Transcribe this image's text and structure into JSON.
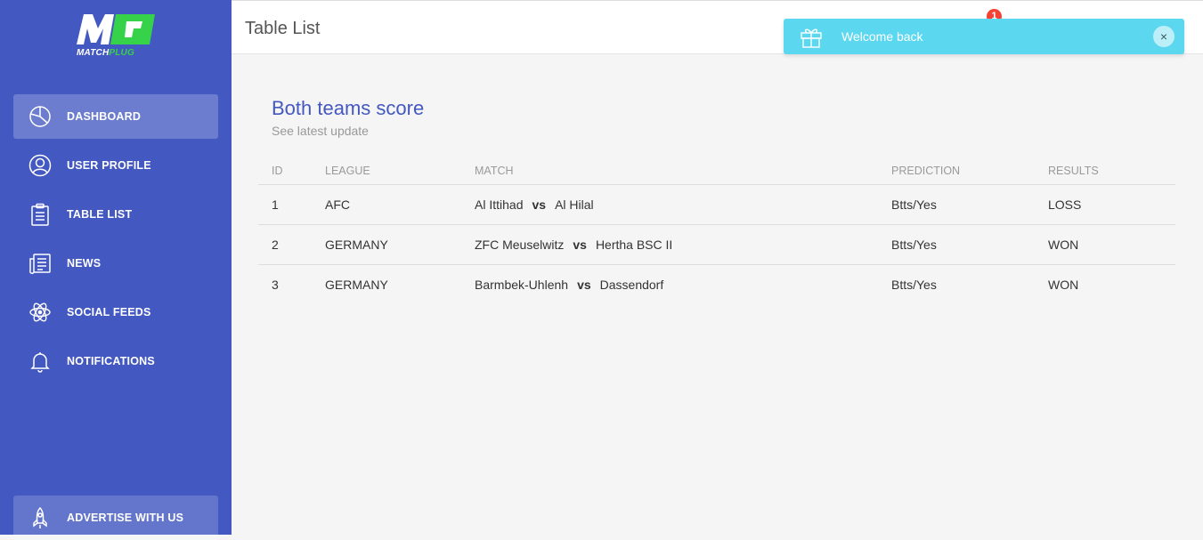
{
  "brand": {
    "logo_letters": "MP",
    "wordmark_a": "MATCH",
    "wordmark_b": "PLUG",
    "primary_color": "#4358c0",
    "accent_color": "#35d24a"
  },
  "sidebar": {
    "items": [
      {
        "label": "DASHBOARD",
        "icon": "pie-chart-icon",
        "active": true
      },
      {
        "label": "USER PROFILE",
        "icon": "user-icon"
      },
      {
        "label": "TABLE LIST",
        "icon": "clipboard-icon"
      },
      {
        "label": "NEWS",
        "icon": "newspaper-icon"
      },
      {
        "label": "SOCIAL FEEDS",
        "icon": "atom-icon"
      },
      {
        "label": "NOTIFICATIONS",
        "icon": "bell-icon"
      }
    ],
    "bottom": {
      "label": "ADVERTISE WITH US",
      "icon": "rocket-icon"
    }
  },
  "header": {
    "title": "Table List",
    "notification_count": "1"
  },
  "toast": {
    "message": "Welcome back",
    "icon": "gift-icon",
    "close": "×",
    "color": "#5bd7f0"
  },
  "card": {
    "title": "Both teams score",
    "subtitle": "See latest update"
  },
  "table": {
    "columns": [
      "ID",
      "LEAGUE",
      "MATCH",
      "PREDICTION",
      "RESULTS"
    ],
    "rows": [
      {
        "id": "1",
        "league": "AFC",
        "home": "Al Ittihad",
        "vs": "vs",
        "away": "Al Hilal",
        "prediction": "Btts/Yes",
        "result": "LOSS"
      },
      {
        "id": "2",
        "league": "GERMANY",
        "home": "ZFC Meuselwitz",
        "vs": "vs",
        "away": "Hertha BSC II",
        "prediction": "Btts/Yes",
        "result": "WON"
      },
      {
        "id": "3",
        "league": "GERMANY",
        "home": "Barmbek-Uhlenh",
        "vs": "vs",
        "away": "Dassendorf",
        "prediction": "Btts/Yes",
        "result": "WON"
      }
    ]
  }
}
